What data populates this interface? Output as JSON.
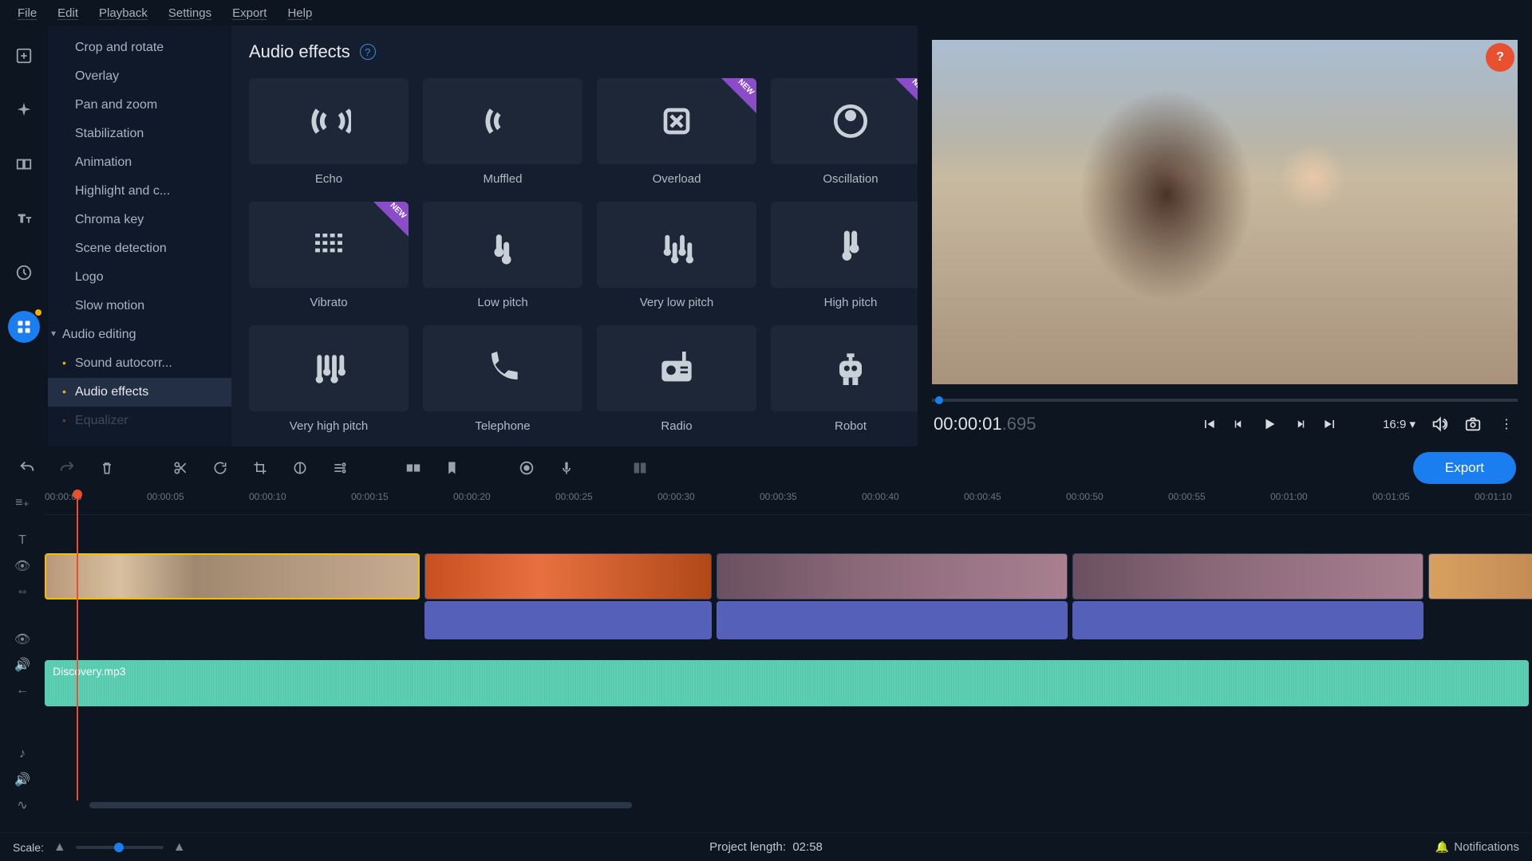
{
  "menubar": [
    "File",
    "Edit",
    "Playback",
    "Settings",
    "Export",
    "Help"
  ],
  "sidebar": {
    "items": [
      {
        "label": "Crop and rotate",
        "indent": 1
      },
      {
        "label": "Overlay",
        "indent": 1
      },
      {
        "label": "Pan and zoom",
        "indent": 1
      },
      {
        "label": "Stabilization",
        "indent": 1
      },
      {
        "label": "Animation",
        "indent": 1
      },
      {
        "label": "Highlight and c...",
        "indent": 1
      },
      {
        "label": "Chroma key",
        "indent": 1
      },
      {
        "label": "Scene detection",
        "indent": 1
      },
      {
        "label": "Logo",
        "indent": 1
      },
      {
        "label": "Slow motion",
        "indent": 1
      },
      {
        "label": "Audio editing",
        "parent": true
      },
      {
        "label": "Sound autocorr...",
        "indent": 1,
        "dot": true
      },
      {
        "label": "Audio effects",
        "indent": 1,
        "dot": true,
        "selected": true
      },
      {
        "label": "Equalizer",
        "indent": 1,
        "dot": true,
        "fade": true
      }
    ]
  },
  "content": {
    "title": "Audio effects",
    "effects": [
      {
        "label": "Echo",
        "icon": "echo"
      },
      {
        "label": "Muffled",
        "icon": "muffled"
      },
      {
        "label": "Overload",
        "icon": "overload",
        "new": true
      },
      {
        "label": "Oscillation",
        "icon": "oscillation",
        "new": true
      },
      {
        "label": "Vibrato",
        "icon": "vibrato",
        "new": true
      },
      {
        "label": "Low pitch",
        "icon": "lowpitch"
      },
      {
        "label": "Very low pitch",
        "icon": "verylowpitch"
      },
      {
        "label": "High pitch",
        "icon": "highpitch"
      },
      {
        "label": "Very high pitch",
        "icon": "veryhighpitch"
      },
      {
        "label": "Telephone",
        "icon": "telephone"
      },
      {
        "label": "Radio",
        "icon": "radio"
      },
      {
        "label": "Robot",
        "icon": "robot"
      }
    ]
  },
  "preview": {
    "timecode": "00:00:01",
    "timecode_ms": ".695",
    "ratio": "16:9"
  },
  "export_label": "Export",
  "timeline": {
    "ticks": [
      "00:00:00",
      "00:00:05",
      "00:00:10",
      "00:00:15",
      "00:00:20",
      "00:00:25",
      "00:00:30",
      "00:00:35",
      "00:00:40",
      "00:00:45",
      "00:00:50",
      "00:00:55",
      "00:01:00",
      "00:01:05",
      "00:01:10"
    ],
    "audio_clip": "Discovery.mp3"
  },
  "status": {
    "scale_label": "Scale:",
    "project_length_label": "Project length:",
    "project_length_value": "02:58",
    "notifications": "Notifications"
  }
}
